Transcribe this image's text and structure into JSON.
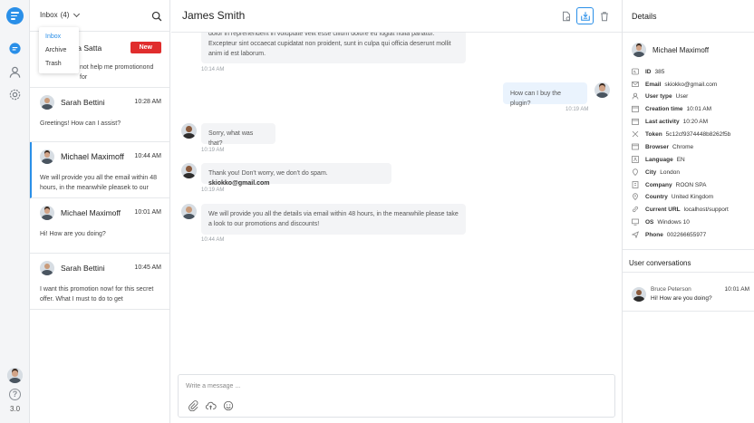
{
  "rail": {
    "version": "3.0",
    "help_label": "?"
  },
  "list": {
    "inbox_label": "Inbox",
    "inbox_count": "(4)",
    "dropdown": [
      "Inbox",
      "Archive",
      "Trash"
    ],
    "conversations": [
      {
        "name": "Melissa Satta",
        "name_visible": "sa Satta",
        "time": "",
        "preview": "not help me promotionond for",
        "badge": "New"
      },
      {
        "name": "Sarah Bettini",
        "time": "10:28 AM",
        "preview": "Greetings! How can I assist?"
      },
      {
        "name": "Michael Maximoff",
        "time": "10:44 AM",
        "preview": "We will provide you all the  email within 48 hours, in the meanwhile pleasek to our"
      },
      {
        "name": "Michael Maximoff",
        "time": "10:01 AM",
        "preview": "Hi! How are you doing?"
      },
      {
        "name": "Sarah Bettini",
        "time": "10:45 AM",
        "preview": "I want this promotion now! for this secret offer. What I must to do to get"
      }
    ]
  },
  "chat": {
    "title": "James Smith",
    "messages": [
      {
        "dir": "in",
        "text": "dolor in reprehenderit in voluptate velit esse cillum dolore eu fugiat nulla pariatur. Excepteur sint occaecat cupidatat non proident, sunt in culpa qui officia deserunt mollit anim id est laborum.",
        "time": "10:14 AM"
      },
      {
        "dir": "out",
        "text": "How can I buy the plugin?",
        "time": "10:19 AM"
      },
      {
        "dir": "in",
        "text": "Sorry, what was that?",
        "time": "10:19 AM"
      },
      {
        "dir": "in",
        "text_pre": "Thank you! Don't worry, we don't do spam. ",
        "text_bold": "skiokko@gmail.com",
        "time": "10:19 AM"
      },
      {
        "dir": "in",
        "text": "We will provide you all the details via email within 48 hours, in the meanwhile please take a look to our promotions and discounts!",
        "time": "10:44 AM"
      }
    ],
    "composer_placeholder": "Write a message ..."
  },
  "details": {
    "title": "Details",
    "user_name": "Michael Maximoff",
    "attributes": [
      {
        "key": "ID",
        "value": "385",
        "icon": "id-icon"
      },
      {
        "key": "Email",
        "value": "skiokko@gmail.com",
        "icon": "email-icon"
      },
      {
        "key": "User type",
        "value": "User",
        "icon": "user-icon"
      },
      {
        "key": "Creation time",
        "value": "10:01 AM",
        "icon": "calendar-icon"
      },
      {
        "key": "Last activity",
        "value": "10:20 AM",
        "icon": "calendar-icon"
      },
      {
        "key": "Token",
        "value": "5c12cf9374448b8262f5b",
        "icon": "token-icon"
      },
      {
        "key": "Browser",
        "value": "Chrome",
        "icon": "browser-icon"
      },
      {
        "key": "Language",
        "value": "EN",
        "icon": "language-icon"
      },
      {
        "key": "City",
        "value": "London",
        "icon": "city-icon"
      },
      {
        "key": "Company",
        "value": "ROON SPA",
        "icon": "company-icon"
      },
      {
        "key": "Country",
        "value": "United Kingdom",
        "icon": "country-icon"
      },
      {
        "key": "Current URL",
        "value": "localhost/support",
        "icon": "url-icon"
      },
      {
        "key": "OS",
        "value": "Windows 10",
        "icon": "os-icon"
      },
      {
        "key": "Phone",
        "value": "002266655977",
        "icon": "phone-icon"
      }
    ],
    "conversations_title": "User conversations",
    "conversation": {
      "name": "Bruce Peterson",
      "preview": "Hi! How are you doing?",
      "time": "10:01 AM"
    }
  },
  "colors": {
    "accent": "#2a8fe8",
    "badge": "#e02d2d",
    "bubble_in": "#f3f4f6",
    "bubble_out": "#eaf3fd"
  }
}
